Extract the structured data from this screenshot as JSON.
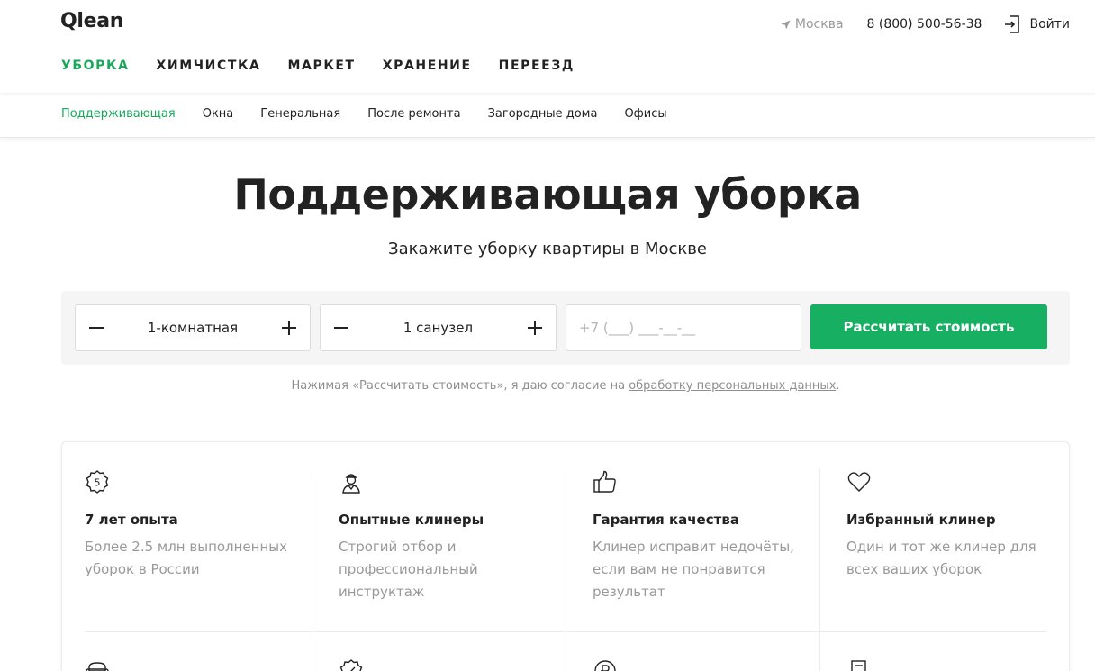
{
  "header": {
    "logo": "Qlean",
    "city": "Москва",
    "phone": "8 (800) 500-56-38",
    "login": "Войти",
    "nav": [
      {
        "label": "УБОРКА",
        "active": true
      },
      {
        "label": "ХИМЧИСТКА",
        "active": false
      },
      {
        "label": "МАРКЕТ",
        "active": false
      },
      {
        "label": "ХРАНЕНИЕ",
        "active": false
      },
      {
        "label": "ПЕРЕЕЗД",
        "active": false
      }
    ]
  },
  "subnav": [
    {
      "label": "Поддерживающая",
      "active": true
    },
    {
      "label": "Окна",
      "active": false
    },
    {
      "label": "Генеральная",
      "active": false
    },
    {
      "label": "После ремонта",
      "active": false
    },
    {
      "label": "Загородные дома",
      "active": false
    },
    {
      "label": "Офисы",
      "active": false
    }
  ],
  "hero": {
    "title": "Поддерживающая уборка",
    "subtitle": "Закажите уборку квартиры в Москве"
  },
  "order": {
    "rooms": "1-комнатная",
    "bathrooms": "1 санузел",
    "phone_placeholder": "+7 (___) ___-__-__",
    "calc_button": "Рассчитать стоимость"
  },
  "consent": {
    "text": "Нажимая «Рассчитать стоимость», я даю согласие на ",
    "link": "обработку персональных данных",
    "end": "."
  },
  "features": [
    {
      "icon": "badge-5-icon",
      "title": "7 лет опыта",
      "text": "Более 2.5 млн выполненных уборок в России"
    },
    {
      "icon": "cleaner-icon",
      "title": "Опытные клинеры",
      "text": "Строгий отбор и профессиональный инструктаж"
    },
    {
      "icon": "thumbs-up-icon",
      "title": "Гарантия качества",
      "text": "Клинер исправит недочёты, если вам не понравится результат"
    },
    {
      "icon": "heart-icon",
      "title": "Избранный клинер",
      "text": "Один и тот же клинер для всех ваших уборок"
    }
  ],
  "colors": {
    "accent": "#17a85a",
    "button": "#17b063",
    "muted": "#999999"
  }
}
